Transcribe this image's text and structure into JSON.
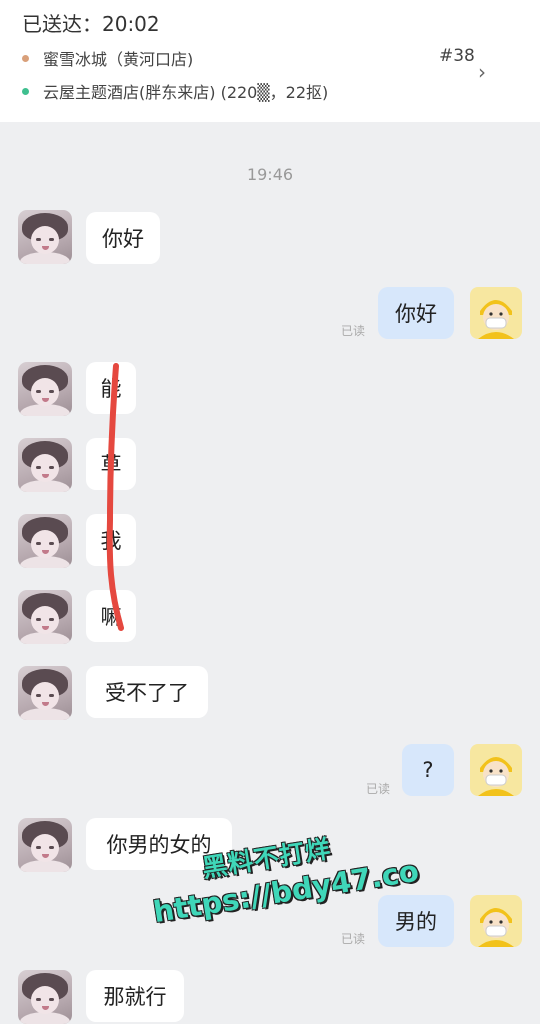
{
  "order": {
    "delivered_label": "已送达：20:02",
    "shop": "蜜雪冰城（黄河口店)",
    "order_number": "#38",
    "destination": "云屋主题酒店(胖东来店) (220▒，22抠)"
  },
  "colors": {
    "shop_dot": "#d9a07a",
    "dest_dot": "#3fbf8f",
    "incoming_bubble": "#ffffff",
    "outgoing_bubble": "#d7e7fb",
    "annotation_stroke": "#e5483f"
  },
  "chat": {
    "timestamp": "19:46",
    "read_label": "已读",
    "messages": [
      {
        "dir": "in",
        "text": "你好"
      },
      {
        "dir": "out",
        "text": "你好"
      },
      {
        "dir": "in",
        "text": "能"
      },
      {
        "dir": "in",
        "text": "草"
      },
      {
        "dir": "in",
        "text": "我"
      },
      {
        "dir": "in",
        "text": "嘛"
      },
      {
        "dir": "in",
        "text": "受不了了"
      },
      {
        "dir": "out",
        "text": "?"
      },
      {
        "dir": "in",
        "text": "你男的女的"
      },
      {
        "dir": "out",
        "text": "男的"
      },
      {
        "dir": "in",
        "text": "那就行"
      }
    ]
  },
  "watermark": {
    "line1": "黑料不打烊",
    "line2": "https://bdy47.co"
  }
}
